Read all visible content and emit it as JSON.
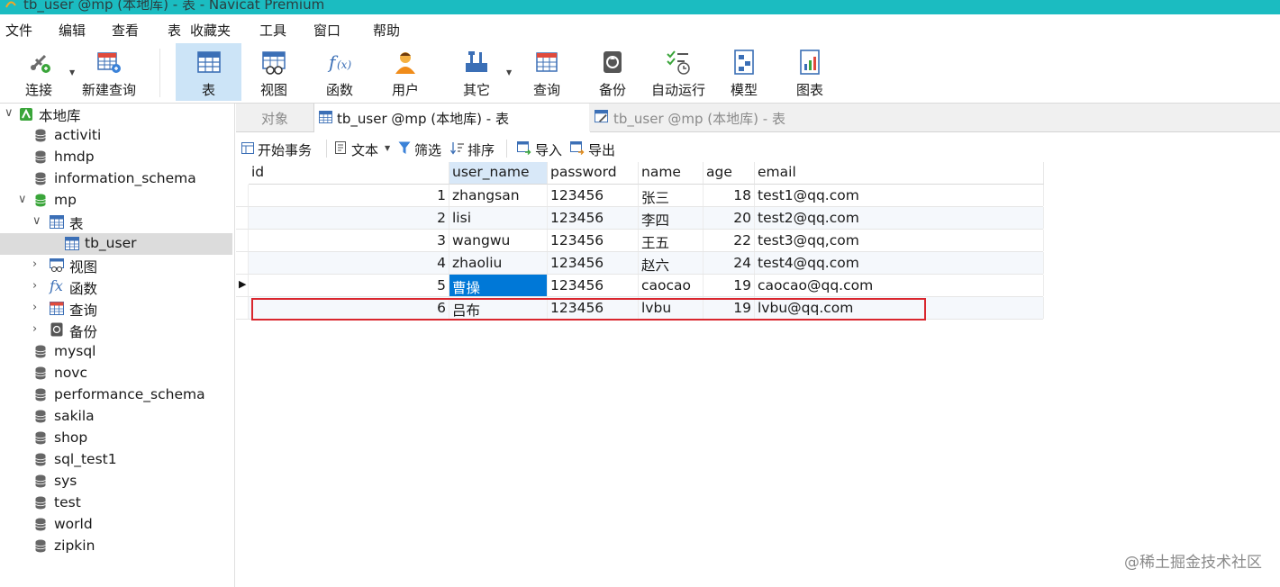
{
  "window": {
    "title": "tb_user @mp (本地库) - 表 - Navicat Premium"
  },
  "menu": [
    "文件",
    "编辑",
    "查看",
    "表",
    "收藏夹",
    "工具",
    "窗口",
    "帮助"
  ],
  "toolbar": {
    "connect": "连接",
    "new_query": "新建查询",
    "table": "表",
    "view": "视图",
    "function": "函数",
    "user": "用户",
    "other": "其它",
    "query": "查询",
    "backup": "备份",
    "auto_run": "自动运行",
    "model": "模型",
    "chart": "图表"
  },
  "sidebar": {
    "root": "本地库",
    "databases": [
      "activiti",
      "hmdp",
      "information_schema",
      "mp"
    ],
    "mp_children": {
      "tables": "表",
      "table_item": "tb_user",
      "views": "视图",
      "functions": "函数",
      "queries": "查询",
      "backups": "备份"
    },
    "more_databases": [
      "mysql",
      "novc",
      "performance_schema",
      "sakila",
      "shop",
      "sql_test1",
      "sys",
      "test",
      "world",
      "zipkin"
    ]
  },
  "tabs": {
    "objects": "对象",
    "tab1": "tb_user @mp (本地库) - 表",
    "tab2": "tb_user @mp (本地库) - 表"
  },
  "subtoolbar": {
    "begin_tx": "开始事务",
    "text": "文本",
    "filter": "筛选",
    "sort": "排序",
    "import": "导入",
    "export": "导出"
  },
  "grid": {
    "columns": [
      "id",
      "user_name",
      "password",
      "name",
      "age",
      "email"
    ],
    "rows": [
      [
        "1",
        "zhangsan",
        "123456",
        "张三",
        "18",
        "test1@qq.com"
      ],
      [
        "2",
        "lisi",
        "123456",
        "李四",
        "20",
        "test2@qq.com"
      ],
      [
        "3",
        "wangwu",
        "123456",
        "王五",
        "22",
        "test3@qq,com"
      ],
      [
        "4",
        "zhaoliu",
        "123456",
        "赵六",
        "24",
        "test4@qq.com"
      ],
      [
        "5",
        "曹操",
        "123456",
        "caocao",
        "19",
        "caocao@qq.com"
      ],
      [
        "6",
        "吕布",
        "123456",
        "lvbu",
        "19",
        "lvbu@qq.com"
      ]
    ]
  },
  "watermark": "@稀土掘金技术社区",
  "colors": {
    "titlebar": "#1bbcc1",
    "selected_cell": "#0078d7",
    "highlight_box": "#d9262e",
    "active_toolbar": "#cce4f7"
  }
}
